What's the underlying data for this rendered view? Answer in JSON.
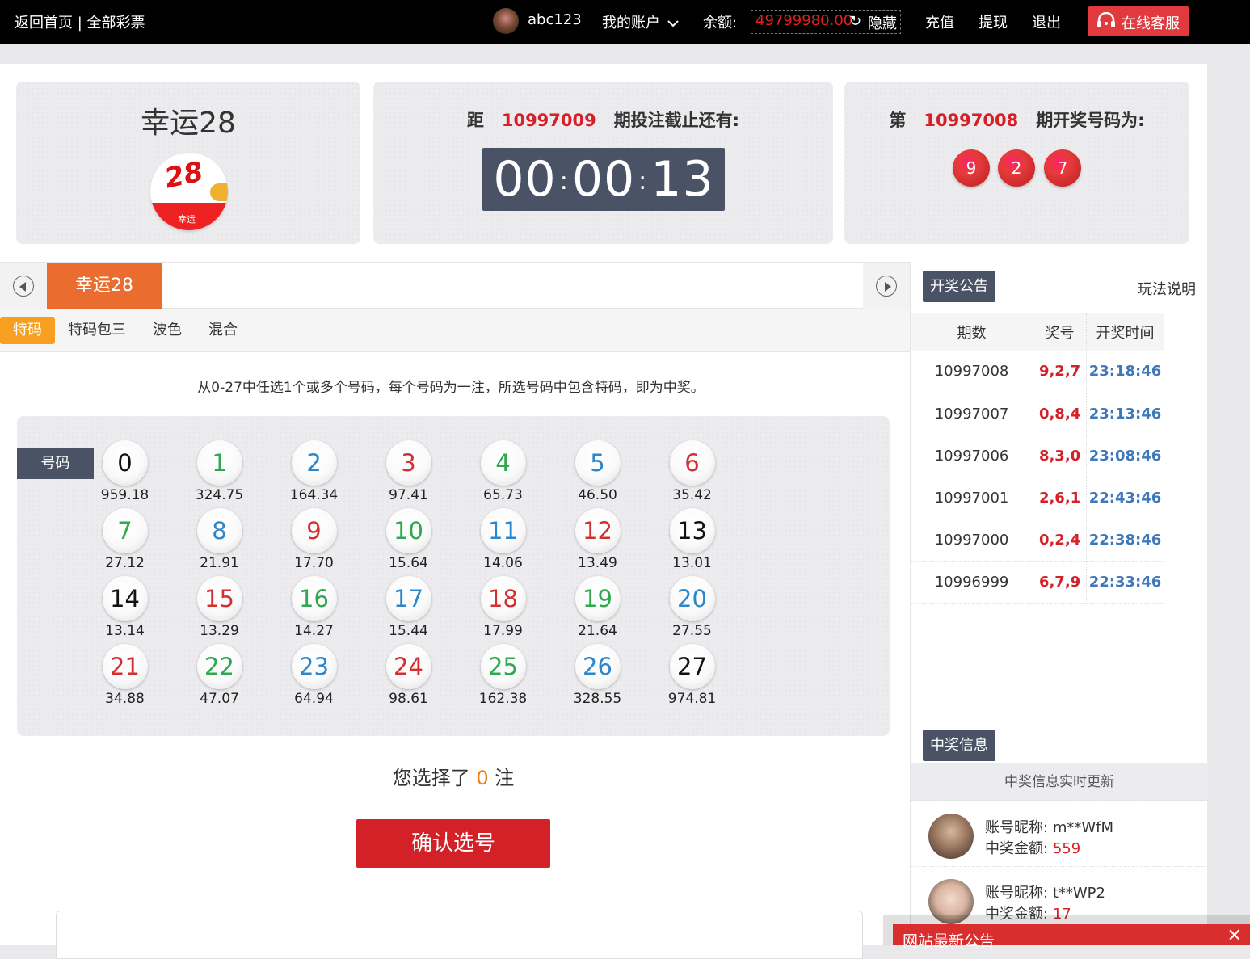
{
  "topbar": {
    "home_link": "返回首页 | 全部彩票",
    "username": "abc123",
    "my_account": "我的账户",
    "balance_label": "余额:",
    "balance_value": "49799980.00",
    "hide_label": "隐藏",
    "recharge": "充值",
    "withdraw": "提现",
    "logout": "退出",
    "customer_service": "在线客服"
  },
  "lottery": {
    "name": "幸运28",
    "logo_number": "28",
    "logo_caption": "幸运"
  },
  "countdown": {
    "prefix": "距",
    "period": "10997009",
    "suffix": "期投注截止还有:",
    "hh": "00",
    "mm": "00",
    "ss": "13"
  },
  "last_result": {
    "prefix": "第",
    "period": "10997008",
    "suffix": "期开奖号码为:",
    "balls": [
      "9",
      "2",
      "7"
    ]
  },
  "game_tab": "幸运28",
  "subtabs": [
    "特码",
    "特码包三",
    "波色",
    "混合"
  ],
  "description": "从0-27中任选1个或多个号码，每个号码为一注，所选号码中包含特码，即为中奖。",
  "number_label": "号码",
  "numbers": [
    {
      "n": "0",
      "odds": "959.18",
      "color": "black"
    },
    {
      "n": "1",
      "odds": "324.75",
      "color": "green"
    },
    {
      "n": "2",
      "odds": "164.34",
      "color": "blue"
    },
    {
      "n": "3",
      "odds": "97.41",
      "color": "red"
    },
    {
      "n": "4",
      "odds": "65.73",
      "color": "green"
    },
    {
      "n": "5",
      "odds": "46.50",
      "color": "blue"
    },
    {
      "n": "6",
      "odds": "35.42",
      "color": "red"
    },
    {
      "n": "7",
      "odds": "27.12",
      "color": "green"
    },
    {
      "n": "8",
      "odds": "21.91",
      "color": "blue"
    },
    {
      "n": "9",
      "odds": "17.70",
      "color": "red"
    },
    {
      "n": "10",
      "odds": "15.64",
      "color": "green"
    },
    {
      "n": "11",
      "odds": "14.06",
      "color": "blue"
    },
    {
      "n": "12",
      "odds": "13.49",
      "color": "red"
    },
    {
      "n": "13",
      "odds": "13.01",
      "color": "black"
    },
    {
      "n": "14",
      "odds": "13.14",
      "color": "black"
    },
    {
      "n": "15",
      "odds": "13.29",
      "color": "red"
    },
    {
      "n": "16",
      "odds": "14.27",
      "color": "green"
    },
    {
      "n": "17",
      "odds": "15.44",
      "color": "blue"
    },
    {
      "n": "18",
      "odds": "17.99",
      "color": "red"
    },
    {
      "n": "19",
      "odds": "21.64",
      "color": "green"
    },
    {
      "n": "20",
      "odds": "27.55",
      "color": "blue"
    },
    {
      "n": "21",
      "odds": "34.88",
      "color": "red"
    },
    {
      "n": "22",
      "odds": "47.07",
      "color": "green"
    },
    {
      "n": "23",
      "odds": "64.94",
      "color": "blue"
    },
    {
      "n": "24",
      "odds": "98.61",
      "color": "red"
    },
    {
      "n": "25",
      "odds": "162.38",
      "color": "green"
    },
    {
      "n": "26",
      "odds": "328.55",
      "color": "blue"
    },
    {
      "n": "27",
      "odds": "974.81",
      "color": "black"
    }
  ],
  "selection": {
    "prefix": "您选择了",
    "count": "0",
    "suffix": "注"
  },
  "confirm_label": "确认选号",
  "sidebar": {
    "announce_tag": "开奖公告",
    "rules_link": "玩法说明",
    "columns": [
      "期数",
      "奖号",
      "开奖时间"
    ],
    "results": [
      {
        "period": "10997008",
        "numbers": "9,2,7",
        "time": "23:18:46"
      },
      {
        "period": "10997007",
        "numbers": "0,8,4",
        "time": "23:13:46"
      },
      {
        "period": "10997006",
        "numbers": "8,3,0",
        "time": "23:08:46"
      },
      {
        "period": "10997001",
        "numbers": "2,6,1",
        "time": "22:43:46"
      },
      {
        "period": "10997000",
        "numbers": "0,2,4",
        "time": "22:38:46"
      },
      {
        "period": "10996999",
        "numbers": "6,7,9",
        "time": "22:33:46"
      }
    ],
    "winners_tag": "中奖信息",
    "winners_subtitle": "中奖信息实时更新",
    "nick_label": "账号昵称:",
    "amount_label": "中奖金额:",
    "winners": [
      {
        "nick": "m**WfM",
        "amount": "559"
      },
      {
        "nick": "t**WP2",
        "amount": "17"
      }
    ]
  },
  "notice": {
    "title": "网站最新公告",
    "close": "✕"
  },
  "colors": {
    "accent_orange": "#ea6c2e",
    "red": "#d42128",
    "slate": "#4a5366",
    "subtab_active": "#f7a020"
  }
}
